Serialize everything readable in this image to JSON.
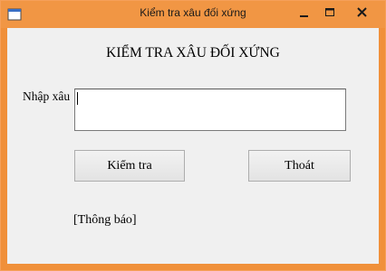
{
  "window": {
    "title": "Kiểm tra xâu đối xứng",
    "controls": {
      "minimize_icon": "minimize-icon",
      "maximize_icon": "maximize-icon",
      "close_icon": "close-icon"
    },
    "accent_color": "#f19644"
  },
  "form": {
    "heading": "KIỂM TRA XÂU ĐỐI XỨNG",
    "input_label": "Nhập xâu",
    "input_value": "",
    "check_button": "Kiểm tra",
    "exit_button": "Thoát",
    "status_text": "[Thông báo]"
  }
}
